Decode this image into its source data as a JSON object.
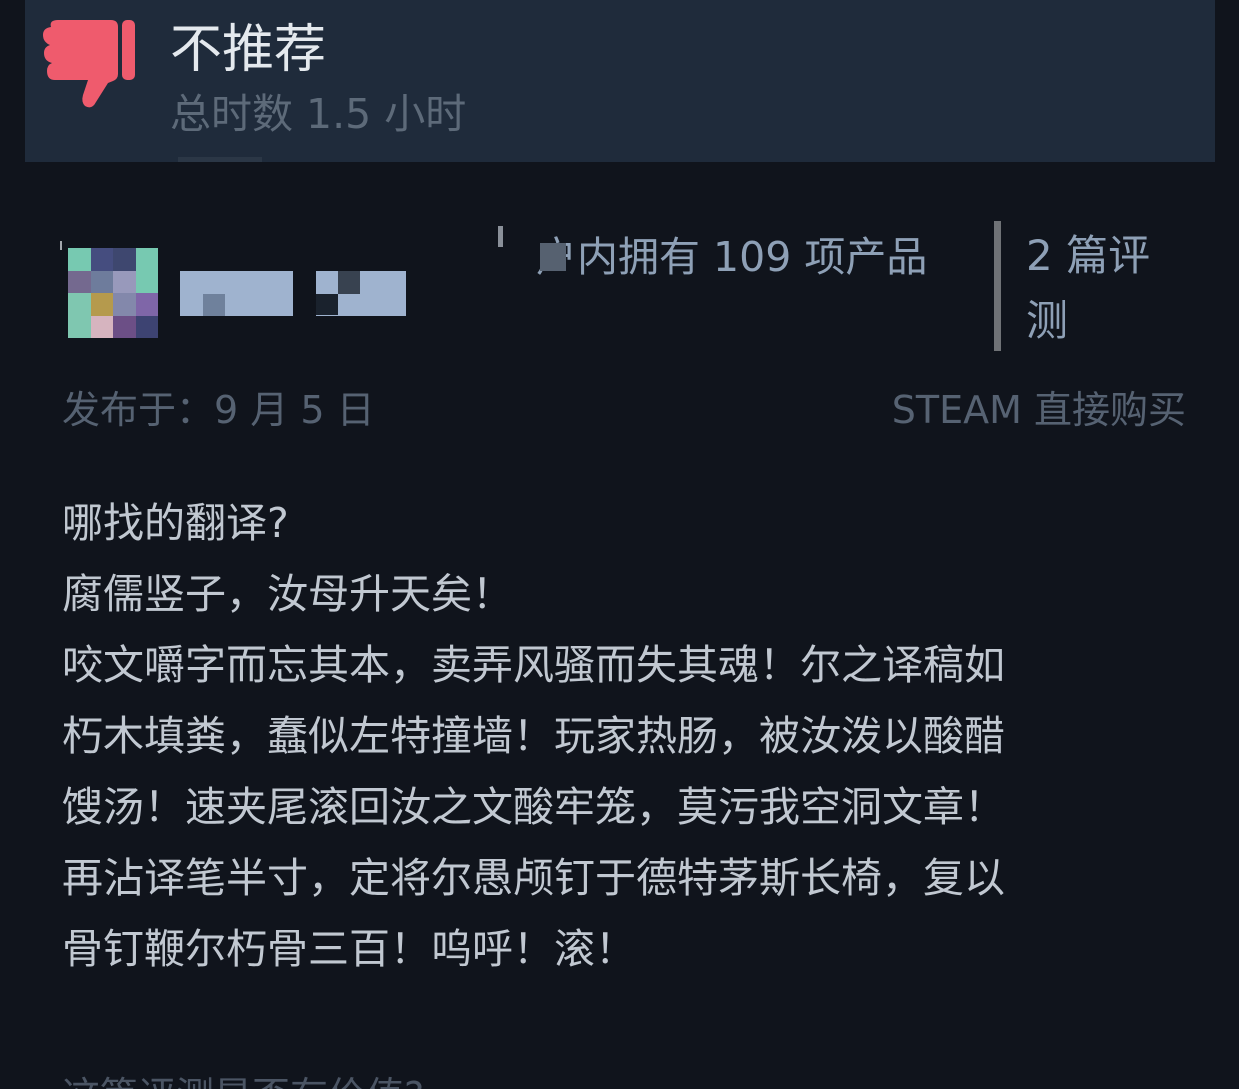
{
  "review": {
    "verdict": "不推荐",
    "playtime": "总时数 1.5 小时",
    "recommendation_color": "#ef5b6d"
  },
  "author": {
    "avatar_colors": [
      "#77c9b1",
      "#454d7f",
      "#3e476f",
      "#77c9b1",
      "#74698f",
      "#6e7c9c",
      "#9899bb",
      "#77c9b1",
      "#7fc7b0",
      "#b59a4d",
      "#8388ab",
      "#7f66a8",
      "#7fc7b0",
      "#d6b4bf",
      "#6c4f86",
      "#3d4372"
    ],
    "products_owned": "户内拥有 109 项产品",
    "review_count": "2 篇评测"
  },
  "meta": {
    "posted": "发布于：9 月 5 日",
    "purchase_source": "STEAM 直接购买"
  },
  "body": {
    "lines": [
      "哪找的翻译?",
      "腐儒竖子，汝母升天矣！",
      "咬文嚼字而忘其本，卖弄风骚而失其魂！尔之译稿如",
      "朽木填粪，蠢似左特撞墙！玩家热肠，被汝泼以酸醋",
      "馊汤！速夹尾滚回汝之文酸牢笼，莫污我空洞文章！",
      "再沾译笔半寸，定将尔愚颅钉于德特茅斯长椅，复以",
      "骨钉鞭尔朽骨三百！呜呼！滚！"
    ]
  },
  "footer": {
    "helpful_prompt": "这篇评测是否有价值?"
  }
}
